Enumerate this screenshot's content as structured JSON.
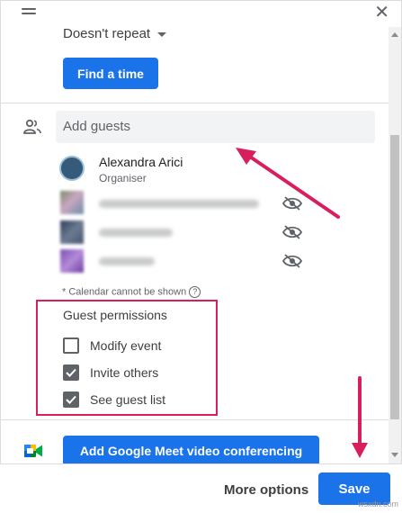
{
  "header": {
    "close_glyph": "✕"
  },
  "event": {
    "repeat_label": "Doesn't repeat",
    "find_time_label": "Find a time"
  },
  "guests": {
    "placeholder": "Add guests",
    "organiser": {
      "name": "Alexandra Arici",
      "role": "Organiser"
    },
    "note": "* Calendar cannot be shown",
    "note_help_glyph": "?"
  },
  "permissions": {
    "title": "Guest permissions",
    "options": [
      {
        "label": "Modify event",
        "checked": false
      },
      {
        "label": "Invite others",
        "checked": true
      },
      {
        "label": "See guest list",
        "checked": true
      }
    ]
  },
  "meet": {
    "label": "Add Google Meet video conferencing"
  },
  "footer": {
    "more_label": "More options",
    "save_label": "Save"
  },
  "watermark": "wsxdn.com",
  "colors": {
    "accent": "#1a73e8",
    "annotation": "#d81e5b"
  }
}
